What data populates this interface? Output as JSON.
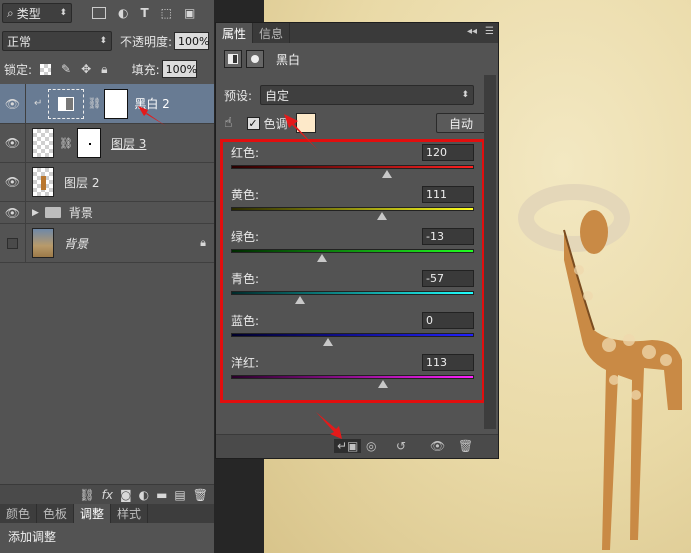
{
  "layers_panel": {
    "filter_label": "类型",
    "blend_mode": "正常",
    "opacity_label": "不透明度:",
    "opacity_value": "100%",
    "lock_label": "锁定:",
    "fill_label": "填充:",
    "fill_value": "100%",
    "layers": [
      {
        "name": "黑白 2",
        "type": "adjustment",
        "visible": true,
        "selected": true
      },
      {
        "name": "图层 3",
        "type": "masked",
        "visible": true,
        "selected": false
      },
      {
        "name": "图层 2",
        "type": "pixel",
        "visible": true,
        "selected": false
      },
      {
        "name": "背景",
        "type": "group",
        "visible": true,
        "selected": false
      },
      {
        "name": "背景",
        "type": "background",
        "visible": false,
        "selected": false,
        "locked": true
      }
    ],
    "bottom_tabs": [
      "颜色",
      "色板",
      "调整",
      "样式"
    ],
    "active_tab": "调整",
    "adjust_heading": "添加调整"
  },
  "properties": {
    "tabs": [
      "属性",
      "信息"
    ],
    "active_tab": "属性",
    "title": "黑白",
    "preset_label": "预设:",
    "preset_value": "自定",
    "tint_label": "色调",
    "tint_checked": true,
    "tint_color": "#fde9c9",
    "auto_button": "自动",
    "sliders": [
      {
        "label": "红色:",
        "value": "120",
        "num": 120,
        "gradient": [
          "#2a0000",
          "#ff2020"
        ]
      },
      {
        "label": "黄色:",
        "value": "111",
        "num": 111,
        "gradient": [
          "#2a2a00",
          "#ffff20"
        ]
      },
      {
        "label": "绿色:",
        "value": "-13",
        "num": -13,
        "gradient": [
          "#002a00",
          "#20ff20"
        ]
      },
      {
        "label": "青色:",
        "value": "-57",
        "num": -57,
        "gradient": [
          "#002a2a",
          "#20ffff"
        ]
      },
      {
        "label": "蓝色:",
        "value": "0",
        "num": 0,
        "gradient": [
          "#00002a",
          "#2020ff"
        ]
      },
      {
        "label": "洋红:",
        "value": "113",
        "num": 113,
        "gradient": [
          "#2a002a",
          "#ff20ff"
        ]
      }
    ],
    "slider_range": [
      -200,
      300
    ]
  },
  "colors": {
    "highlight": "#e20e0e",
    "panel": "#535353",
    "canvas": "#ecdcaa"
  }
}
